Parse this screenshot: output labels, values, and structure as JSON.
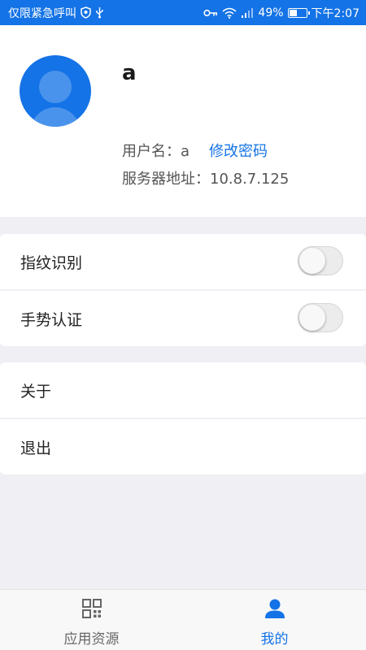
{
  "status_bar": {
    "left_text": "仅限紧急呼叫",
    "battery_percent": "49%",
    "battery_level": 0.49,
    "time": "下午2:07",
    "icons": [
      "shield-icon",
      "usb-icon",
      "key-icon",
      "wifi-icon",
      "signal-icon",
      "battery-icon"
    ]
  },
  "profile": {
    "name": "a",
    "username_label": "用户名：",
    "username": "a",
    "change_password": "修改密码",
    "server_label": "服务器地址：",
    "server": "10.8.7.125"
  },
  "settings": {
    "security": [
      {
        "label": "指纹识别",
        "enabled": false
      },
      {
        "label": "手势认证",
        "enabled": false
      }
    ],
    "general": [
      {
        "label": "关于"
      },
      {
        "label": "退出"
      }
    ]
  },
  "bottom_nav": {
    "tabs": [
      {
        "label": "应用资源",
        "icon": "grid-icon",
        "active": false
      },
      {
        "label": "我的",
        "icon": "person-icon",
        "active": true
      }
    ]
  },
  "colors": {
    "accent": "#1473e6",
    "background": "#efeff4",
    "card": "#ffffff"
  }
}
